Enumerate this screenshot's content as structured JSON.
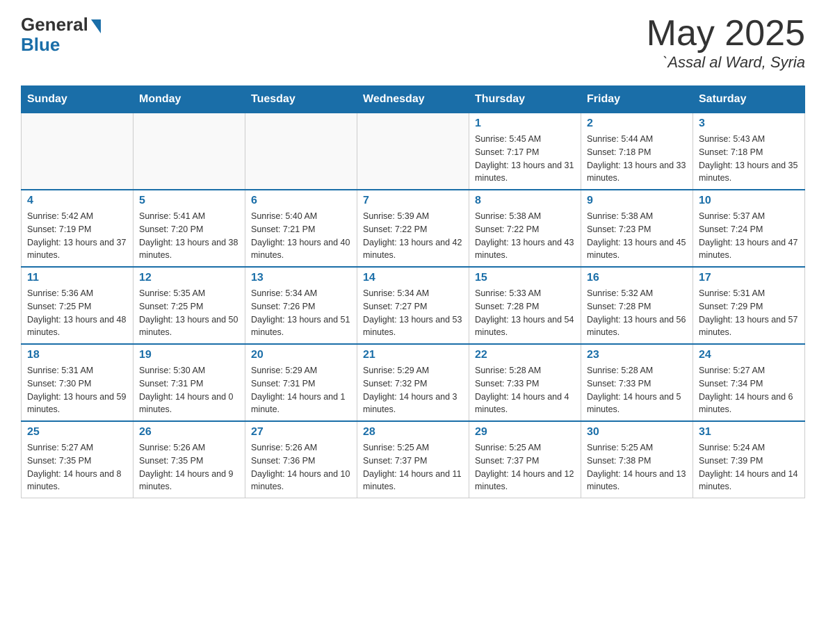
{
  "header": {
    "logo_general": "General",
    "logo_blue": "Blue",
    "month_year": "May 2025",
    "location": "`Assal al Ward, Syria"
  },
  "days_of_week": [
    "Sunday",
    "Monday",
    "Tuesday",
    "Wednesday",
    "Thursday",
    "Friday",
    "Saturday"
  ],
  "weeks": [
    [
      {
        "day": "",
        "info": ""
      },
      {
        "day": "",
        "info": ""
      },
      {
        "day": "",
        "info": ""
      },
      {
        "day": "",
        "info": ""
      },
      {
        "day": "1",
        "info": "Sunrise: 5:45 AM\nSunset: 7:17 PM\nDaylight: 13 hours and 31 minutes."
      },
      {
        "day": "2",
        "info": "Sunrise: 5:44 AM\nSunset: 7:18 PM\nDaylight: 13 hours and 33 minutes."
      },
      {
        "day": "3",
        "info": "Sunrise: 5:43 AM\nSunset: 7:18 PM\nDaylight: 13 hours and 35 minutes."
      }
    ],
    [
      {
        "day": "4",
        "info": "Sunrise: 5:42 AM\nSunset: 7:19 PM\nDaylight: 13 hours and 37 minutes."
      },
      {
        "day": "5",
        "info": "Sunrise: 5:41 AM\nSunset: 7:20 PM\nDaylight: 13 hours and 38 minutes."
      },
      {
        "day": "6",
        "info": "Sunrise: 5:40 AM\nSunset: 7:21 PM\nDaylight: 13 hours and 40 minutes."
      },
      {
        "day": "7",
        "info": "Sunrise: 5:39 AM\nSunset: 7:22 PM\nDaylight: 13 hours and 42 minutes."
      },
      {
        "day": "8",
        "info": "Sunrise: 5:38 AM\nSunset: 7:22 PM\nDaylight: 13 hours and 43 minutes."
      },
      {
        "day": "9",
        "info": "Sunrise: 5:38 AM\nSunset: 7:23 PM\nDaylight: 13 hours and 45 minutes."
      },
      {
        "day": "10",
        "info": "Sunrise: 5:37 AM\nSunset: 7:24 PM\nDaylight: 13 hours and 47 minutes."
      }
    ],
    [
      {
        "day": "11",
        "info": "Sunrise: 5:36 AM\nSunset: 7:25 PM\nDaylight: 13 hours and 48 minutes."
      },
      {
        "day": "12",
        "info": "Sunrise: 5:35 AM\nSunset: 7:25 PM\nDaylight: 13 hours and 50 minutes."
      },
      {
        "day": "13",
        "info": "Sunrise: 5:34 AM\nSunset: 7:26 PM\nDaylight: 13 hours and 51 minutes."
      },
      {
        "day": "14",
        "info": "Sunrise: 5:34 AM\nSunset: 7:27 PM\nDaylight: 13 hours and 53 minutes."
      },
      {
        "day": "15",
        "info": "Sunrise: 5:33 AM\nSunset: 7:28 PM\nDaylight: 13 hours and 54 minutes."
      },
      {
        "day": "16",
        "info": "Sunrise: 5:32 AM\nSunset: 7:28 PM\nDaylight: 13 hours and 56 minutes."
      },
      {
        "day": "17",
        "info": "Sunrise: 5:31 AM\nSunset: 7:29 PM\nDaylight: 13 hours and 57 minutes."
      }
    ],
    [
      {
        "day": "18",
        "info": "Sunrise: 5:31 AM\nSunset: 7:30 PM\nDaylight: 13 hours and 59 minutes."
      },
      {
        "day": "19",
        "info": "Sunrise: 5:30 AM\nSunset: 7:31 PM\nDaylight: 14 hours and 0 minutes."
      },
      {
        "day": "20",
        "info": "Sunrise: 5:29 AM\nSunset: 7:31 PM\nDaylight: 14 hours and 1 minute."
      },
      {
        "day": "21",
        "info": "Sunrise: 5:29 AM\nSunset: 7:32 PM\nDaylight: 14 hours and 3 minutes."
      },
      {
        "day": "22",
        "info": "Sunrise: 5:28 AM\nSunset: 7:33 PM\nDaylight: 14 hours and 4 minutes."
      },
      {
        "day": "23",
        "info": "Sunrise: 5:28 AM\nSunset: 7:33 PM\nDaylight: 14 hours and 5 minutes."
      },
      {
        "day": "24",
        "info": "Sunrise: 5:27 AM\nSunset: 7:34 PM\nDaylight: 14 hours and 6 minutes."
      }
    ],
    [
      {
        "day": "25",
        "info": "Sunrise: 5:27 AM\nSunset: 7:35 PM\nDaylight: 14 hours and 8 minutes."
      },
      {
        "day": "26",
        "info": "Sunrise: 5:26 AM\nSunset: 7:35 PM\nDaylight: 14 hours and 9 minutes."
      },
      {
        "day": "27",
        "info": "Sunrise: 5:26 AM\nSunset: 7:36 PM\nDaylight: 14 hours and 10 minutes."
      },
      {
        "day": "28",
        "info": "Sunrise: 5:25 AM\nSunset: 7:37 PM\nDaylight: 14 hours and 11 minutes."
      },
      {
        "day": "29",
        "info": "Sunrise: 5:25 AM\nSunset: 7:37 PM\nDaylight: 14 hours and 12 minutes."
      },
      {
        "day": "30",
        "info": "Sunrise: 5:25 AM\nSunset: 7:38 PM\nDaylight: 14 hours and 13 minutes."
      },
      {
        "day": "31",
        "info": "Sunrise: 5:24 AM\nSunset: 7:39 PM\nDaylight: 14 hours and 14 minutes."
      }
    ]
  ]
}
